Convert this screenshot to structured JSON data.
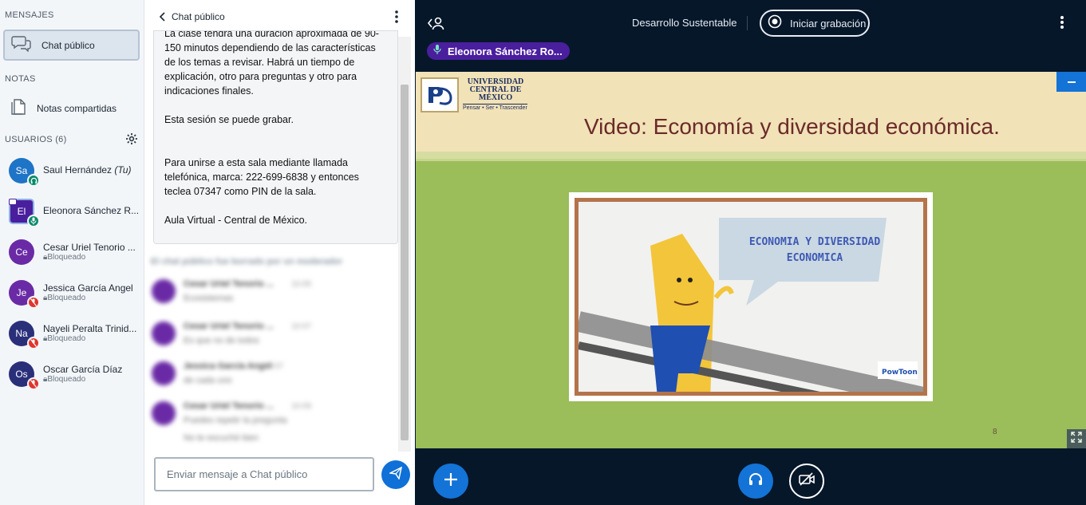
{
  "sidebar": {
    "messages_title": "MENSAJES",
    "public_chat_label": "Chat público",
    "notes_title": "NOTAS",
    "shared_notes_label": "Notas compartidas",
    "users_title": "USUARIOS (6)",
    "users": [
      {
        "initials": "Sa",
        "name": "Saul Hernández",
        "suffix": "(Tu)",
        "status": "",
        "color": "#1e74c6",
        "shape": "circle",
        "badge": "headset"
      },
      {
        "initials": "El",
        "name": "Eleonora Sánchez R...",
        "suffix": "",
        "status": "",
        "color": "#4a1f9e",
        "shape": "square",
        "badge": "mic"
      },
      {
        "initials": "Ce",
        "name": "Cesar Uriel Tenorio ...",
        "suffix": "",
        "status": "Bloqueado",
        "color": "#6a2aa6",
        "shape": "circle",
        "badge": ""
      },
      {
        "initials": "Je",
        "name": "Jessica García Angel",
        "suffix": "",
        "status": "Bloqueado",
        "color": "#6a2aa6",
        "shape": "circle",
        "badge": "muted"
      },
      {
        "initials": "Na",
        "name": "Nayeli Peralta Trinid...",
        "suffix": "",
        "status": "Bloqueado",
        "color": "#2a2f7a",
        "shape": "circle",
        "badge": "muted"
      },
      {
        "initials": "Os",
        "name": "Oscar García Díaz",
        "suffix": "",
        "status": "Bloqueado",
        "color": "#2a2f7a",
        "shape": "circle",
        "badge": "muted"
      }
    ]
  },
  "chat": {
    "title": "Chat público",
    "welcome": [
      "La clase tendrá una duración aproximada de 90-150 minutos dependiendo de las características de los temas a revisar. Habrá un tiempo de explicación, otro para preguntas y otro para indicaciones finales.",
      "Esta sesión se puede grabar.",
      "Para unirse a esta sala mediante llamada telefónica, marca: 222-699-6838 y entonces teclea 07347 como PIN de la sala.",
      "Aula Virtual - Central de México."
    ],
    "moderator_note": "El chat público fue borrado por un moderador",
    "messages": [
      {
        "name": "Cesar Uriel Tenorio ...",
        "time": "10:05",
        "text": "Ecosistemas"
      },
      {
        "name": "Cesar Uriel Tenorio ...",
        "time": "10:07",
        "text": "Es que no de todos"
      },
      {
        "name": "Jessica García Angel",
        "time": "10:07",
        "text": "de cada uno"
      },
      {
        "name": "Cesar Uriel Tenorio ...",
        "time": "10:09",
        "text": "Puedes repetir la pregunta"
      }
    ],
    "message_extra": "No te escuché bien",
    "input_placeholder": "Enviar mensaje a Chat público"
  },
  "main": {
    "room_title": "Desarrollo Sustentable",
    "record_label": "Iniciar grabación",
    "talker_name": "Eleonora Sánchez Ro...",
    "slide": {
      "uni_name": "UNIVERSIDAD CENTRAL DE MÉXICO",
      "uni_motto": "Pensar • Ser • Trascender",
      "title": "Video: Economía y diversidad económica.",
      "video_text": "ECONOMIA Y DIVERSIDAD ECONOMICA",
      "page_number": "8"
    }
  },
  "colors": {
    "accent": "#1473d6",
    "background": "#06172a",
    "talker": "#4a1f9e",
    "muted_badge": "#e0362c",
    "headset_badge": "#0a8a6a"
  }
}
